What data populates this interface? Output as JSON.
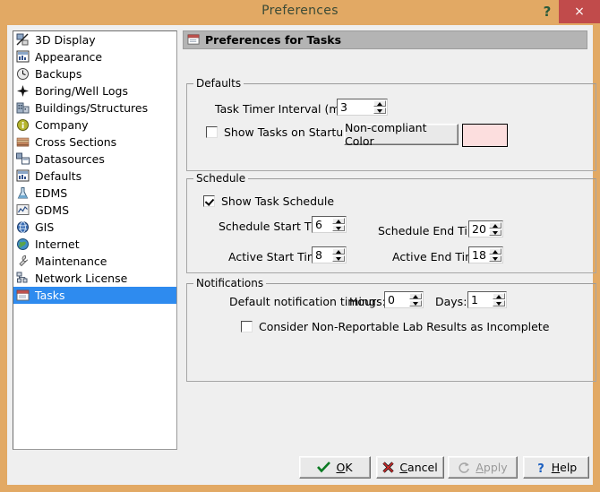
{
  "window": {
    "title": "Preferences",
    "help_glyph": "?",
    "close_glyph": "×",
    "accent_titlebar": "#e2a964",
    "accent_close": "#c14b4b",
    "accent_selection": "#2e8bef"
  },
  "sidebar": {
    "items": [
      {
        "label": "3D Display",
        "icon": "3d-display-icon",
        "selected": false
      },
      {
        "label": "Appearance",
        "icon": "appearance-icon",
        "selected": false
      },
      {
        "label": "Backups",
        "icon": "backups-clock-icon",
        "selected": false
      },
      {
        "label": "Boring/Well Logs",
        "icon": "boring-well-logs-icon",
        "selected": false
      },
      {
        "label": "Buildings/Structures",
        "icon": "buildings-icon",
        "selected": false
      },
      {
        "label": "Company",
        "icon": "company-info-icon",
        "selected": false
      },
      {
        "label": "Cross Sections",
        "icon": "cross-sections-icon",
        "selected": false
      },
      {
        "label": "Datasources",
        "icon": "datasources-icon",
        "selected": false
      },
      {
        "label": "Defaults",
        "icon": "defaults-icon",
        "selected": false
      },
      {
        "label": "EDMS",
        "icon": "edms-flask-icon",
        "selected": false
      },
      {
        "label": "GDMS",
        "icon": "gdms-chart-icon",
        "selected": false
      },
      {
        "label": "GIS",
        "icon": "gis-globe-icon",
        "selected": false
      },
      {
        "label": "Internet",
        "icon": "internet-globe-icon",
        "selected": false
      },
      {
        "label": "Maintenance",
        "icon": "maintenance-wrench-icon",
        "selected": false
      },
      {
        "label": "Network License",
        "icon": "network-license-icon",
        "selected": false
      },
      {
        "label": "Tasks",
        "icon": "tasks-icon",
        "selected": true
      }
    ]
  },
  "panel": {
    "header": "Preferences for Tasks",
    "header_icon": "tasks-icon"
  },
  "defaults": {
    "group_title": "Defaults",
    "task_timer_label": "Task Timer Interval (mins):",
    "task_timer_value": "3",
    "show_tasks_startup_label": "Show Tasks on Startup",
    "show_tasks_startup_checked": false,
    "noncompliant_button": "Non-compliant Color",
    "noncompliant_color": "#fcdede"
  },
  "schedule": {
    "group_title": "Schedule",
    "show_task_schedule_label": "Show Task Schedule",
    "show_task_schedule_checked": true,
    "schedule_start_label": "Schedule Start Time:",
    "schedule_start_value": "6",
    "schedule_end_label": "Schedule End Time:",
    "schedule_end_value": "20",
    "active_start_label": "Active Start Time:",
    "active_start_value": "8",
    "active_end_label": "Active End Time:",
    "active_end_value": "18"
  },
  "notifications": {
    "group_title": "Notifications",
    "default_timing_label": "Default notification timing:",
    "hours_label": "Hours:",
    "hours_value": "0",
    "days_label": "Days:",
    "days_value": "1",
    "nonreportable_label": "Consider Non-Reportable Lab Results as Incomplete",
    "nonreportable_checked": false
  },
  "buttons": {
    "ok": {
      "pre": "",
      "accel": "O",
      "post": "K",
      "icon": "check-icon",
      "disabled": false
    },
    "cancel": {
      "pre": "",
      "accel": "C",
      "post": "ancel",
      "icon": "x-icon",
      "disabled": false
    },
    "apply": {
      "pre": "",
      "accel": "A",
      "post": "pply",
      "icon": "refresh-icon",
      "disabled": true
    },
    "help": {
      "pre": "",
      "accel": "H",
      "post": "elp",
      "icon": "question-icon",
      "disabled": false
    }
  }
}
